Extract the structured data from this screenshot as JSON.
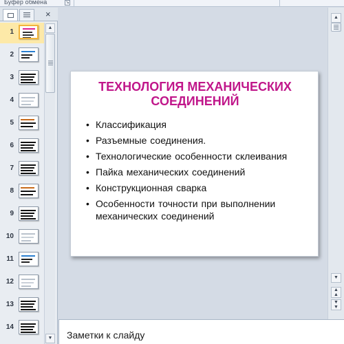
{
  "ribbon": {
    "group_label": "Буфер обмена"
  },
  "left_panel": {
    "tabs": [
      {
        "name": "slides-tab",
        "active": true
      },
      {
        "name": "outline-tab",
        "active": false
      }
    ],
    "close_glyph": "×"
  },
  "thumbnails": [
    {
      "number": "1",
      "selected": true,
      "style": "title"
    },
    {
      "number": "2",
      "selected": false,
      "style": "blue"
    },
    {
      "number": "3",
      "selected": false,
      "style": "dark"
    },
    {
      "number": "4",
      "selected": false,
      "style": "light"
    },
    {
      "number": "5",
      "selected": false,
      "style": "orange"
    },
    {
      "number": "6",
      "selected": false,
      "style": "dark"
    },
    {
      "number": "7",
      "selected": false,
      "style": "dark"
    },
    {
      "number": "8",
      "selected": false,
      "style": "orange"
    },
    {
      "number": "9",
      "selected": false,
      "style": "dark"
    },
    {
      "number": "10",
      "selected": false,
      "style": "light"
    },
    {
      "number": "11",
      "selected": false,
      "style": "blue"
    },
    {
      "number": "12",
      "selected": false,
      "style": "light"
    },
    {
      "number": "13",
      "selected": false,
      "style": "dark"
    },
    {
      "number": "14",
      "selected": false,
      "style": "dark"
    }
  ],
  "slide": {
    "title": "ТЕХНОЛОГИЯ МЕХАНИЧЕСКИХ СОЕДИНЕНИЙ",
    "bullets": [
      "Классификация",
      "Разъемные соединения.",
      "Технологические  особенности склеивания",
      "Пайка  механических  соединений",
      "Конструкционная  сварка",
      "Особенности  точности при выполнении механических  соединений"
    ],
    "title_color": "#c0168a"
  },
  "notes": {
    "placeholder": "Заметки к слайду"
  }
}
